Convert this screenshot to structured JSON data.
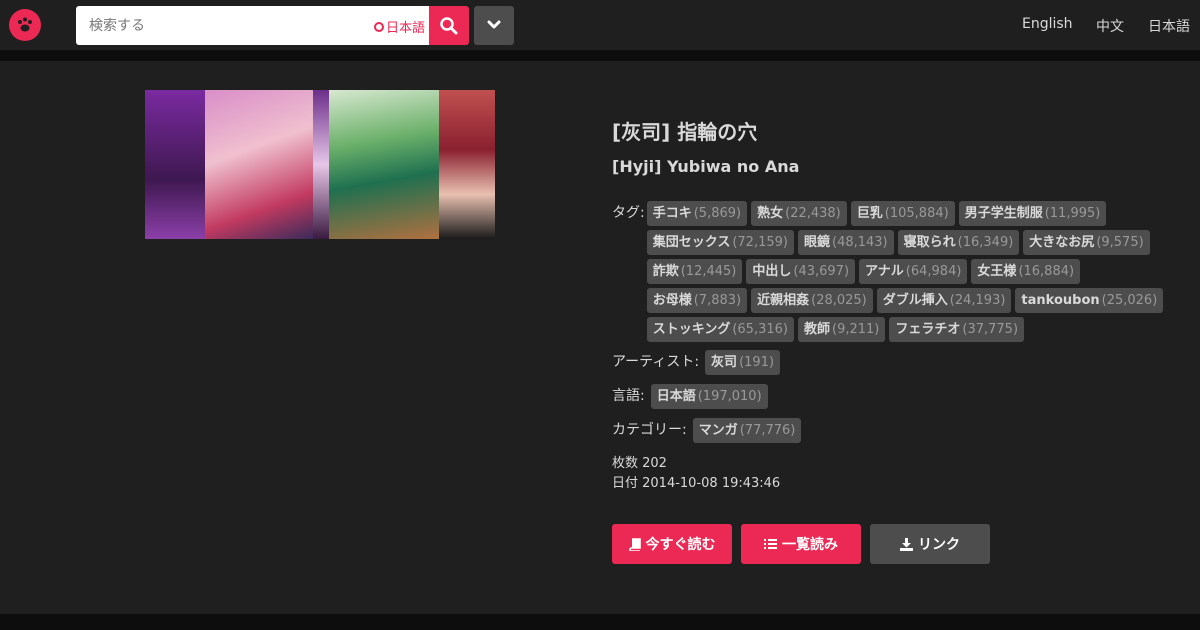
{
  "header": {
    "search_placeholder": "検索する",
    "search_language_option": "日本語",
    "lang_links": [
      "English",
      "中文",
      "日本語"
    ]
  },
  "gallery": {
    "title_japanese": "[灰司] 指輪の穴",
    "title_romanized": "[Hyji] Yubiwa no Ana",
    "tags_label": "タグ:",
    "tags": [
      {
        "name": "手コキ",
        "count": "(5,869)"
      },
      {
        "name": "熟女",
        "count": "(22,438)"
      },
      {
        "name": "巨乳",
        "count": "(105,884)"
      },
      {
        "name": "男子学生制服",
        "count": "(11,995)"
      },
      {
        "name": "集団セックス",
        "count": "(72,159)"
      },
      {
        "name": "眼鏡",
        "count": "(48,143)"
      },
      {
        "name": "寝取られ",
        "count": "(16,349)"
      },
      {
        "name": "大きなお尻",
        "count": "(9,575)"
      },
      {
        "name": "詐欺",
        "count": "(12,445)"
      },
      {
        "name": "中出し",
        "count": "(43,697)"
      },
      {
        "name": "アナル",
        "count": "(64,984)"
      },
      {
        "name": "女王様",
        "count": "(16,884)"
      },
      {
        "name": "お母様",
        "count": "(7,883)"
      },
      {
        "name": "近親相姦",
        "count": "(28,025)"
      },
      {
        "name": "ダブル挿入",
        "count": "(24,193)"
      },
      {
        "name": "tankoubon",
        "count": "(25,026)"
      },
      {
        "name": "ストッキング",
        "count": "(65,316)"
      },
      {
        "name": "教師",
        "count": "(9,211)"
      },
      {
        "name": "フェラチオ",
        "count": "(37,775)"
      }
    ],
    "artist_label": "アーティスト:",
    "artist": {
      "name": "灰司",
      "count": "(191)"
    },
    "language_label": "言語:",
    "language": {
      "name": "日本語",
      "count": "(197,010)"
    },
    "category_label": "カテゴリー:",
    "category": {
      "name": "マンガ",
      "count": "(77,776)"
    },
    "pages_text": "枚数 202",
    "date_text": "日付 2014-10-08 19:43:46",
    "read_now_label": "今すぐ読む",
    "read_all_label": "一覧読み",
    "link_label": "リンク"
  },
  "colors": {
    "accent": "#ec2854",
    "tag_bg": "#4d4d4d",
    "panel_bg": "#1f1f1f",
    "page_bg": "#0d0d0d"
  }
}
